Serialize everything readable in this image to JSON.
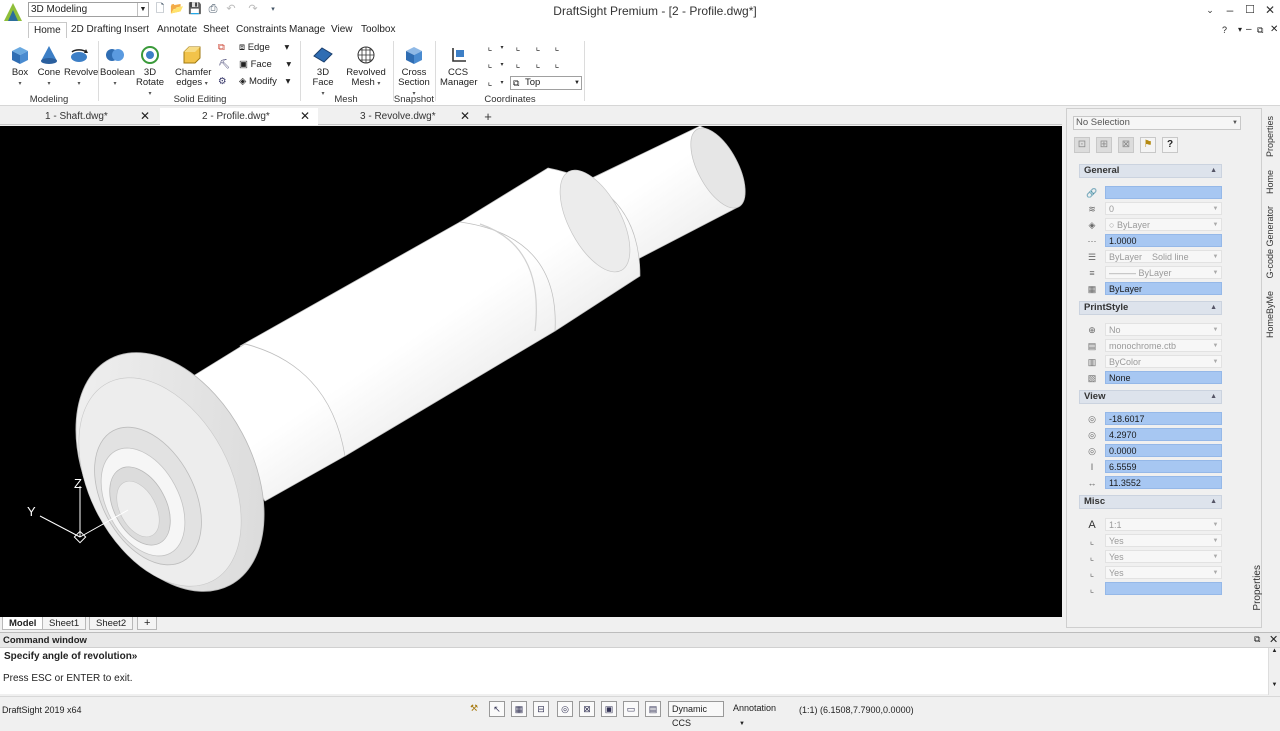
{
  "titlebar": {
    "workspace": "3D Modeling",
    "app_title": "DraftSight Premium - [2 - Profile.dwg*]",
    "help_icon": "?"
  },
  "menu_tabs": [
    "Home",
    "2D Drafting",
    "Insert",
    "Annotate",
    "Sheet",
    "Constraints",
    "Manage",
    "View",
    "Toolbox"
  ],
  "ribbon": {
    "modeling": {
      "box": "Box",
      "cone": "Cone",
      "revolve": "Revolve",
      "group": "Modeling"
    },
    "solid_editing": {
      "boolean": "Boolean",
      "rotate3d": "3D Rotate",
      "chamfer_line1": "Chamfer",
      "chamfer_line2": "edges",
      "edge": "Edge",
      "face": "Face",
      "modify": "Modify",
      "group": "Solid Editing"
    },
    "mesh": {
      "face3d": "3D Face",
      "revolved_line1": "Revolved",
      "revolved_line2": "Mesh",
      "group": "Mesh"
    },
    "snapshot": {
      "cross_line1": "Cross",
      "cross_line2": "Section",
      "group": "Snapshot"
    },
    "coordinates": {
      "ccs_line1": "CCS",
      "ccs_line2": "Manager",
      "view_value": "Top",
      "group": "Coordinates"
    }
  },
  "doc_tabs": [
    {
      "label": "1 - Shaft.dwg*"
    },
    {
      "label": "2 - Profile.dwg*"
    },
    {
      "label": "3 - Revolve.dwg*"
    }
  ],
  "viewport": {
    "axis_z": "Z",
    "axis_y": "Y"
  },
  "sheet_tabs": [
    "Model",
    "Sheet1",
    "Sheet2"
  ],
  "command_window": {
    "title": "Command window",
    "line1": "Specify angle of revolution»",
    "line2": "Press ESC or ENTER to exit."
  },
  "status": {
    "version": "DraftSight 2019 x64",
    "dynamic_ccs": "Dynamic CCS",
    "annotation": "Annotation",
    "scale": "(1:1)",
    "coords": "(6.1508,7.7900,0.0000)"
  },
  "properties": {
    "selection": "No Selection",
    "sections": {
      "general": "General",
      "printstyle": "PrintStyle",
      "view": "View",
      "misc": "Misc"
    },
    "general": {
      "layer": "0",
      "color": "ByLayer",
      "scale": "1.0000",
      "linetype_a": "ByLayer",
      "linetype_b": "Solid line",
      "lineweight": "ByLayer",
      "transparency": "ByLayer"
    },
    "printstyle": {
      "enabled": "No",
      "table": "monochrome.ctb",
      "style": "ByColor",
      "value": "None"
    },
    "view": {
      "v1": "-18.6017",
      "v2": "4.2970",
      "v3": "0.0000",
      "v4": "6.5559",
      "v5": "11.3552"
    },
    "misc": {
      "scale": "1:1",
      "m1": "Yes",
      "m2": "Yes",
      "m3": "Yes"
    },
    "vtabs": [
      "Properties",
      "Home",
      "G-code Generator",
      "HomeByMe"
    ],
    "vlabel": "Properties"
  }
}
